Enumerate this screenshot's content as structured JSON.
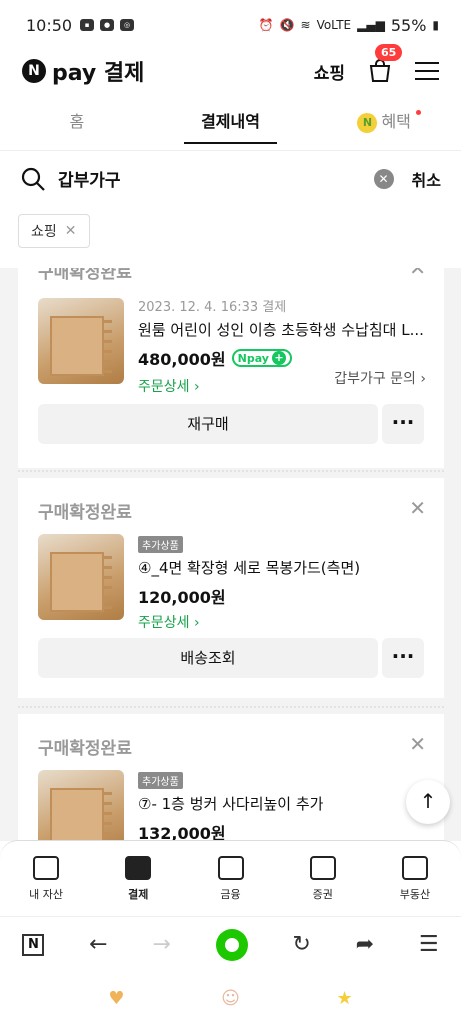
{
  "status": {
    "time": "10:50",
    "battery": "55%",
    "net": "VoLTE"
  },
  "header": {
    "logo_n": "N",
    "logo_text": "pay 결제",
    "shop": "쇼핑",
    "cart_badge": "65"
  },
  "tabs": [
    {
      "label": "홈"
    },
    {
      "label": "결제내역"
    },
    {
      "label": "혜택",
      "coin": "N"
    }
  ],
  "search": {
    "term": "갑부가구",
    "cancel": "취소"
  },
  "filter_chip": {
    "label": "쇼핑"
  },
  "orders": [
    {
      "status": "구매확정완료",
      "date": "2023. 12. 4. 16:33 결제",
      "name": "원룸 어린이 성인 이층 초등학생 수납침대 L...",
      "price": "480,000원",
      "npay_label": "Npay",
      "detail": "주문상세",
      "inquiry": "갑부가구 문의",
      "button": "재구매"
    },
    {
      "status": "구매확정완료",
      "tag": "추가상품",
      "name": "④_4면 확장형 세로 목봉가드(측면)",
      "price": "120,000원",
      "detail": "주문상세",
      "button": "배송조회"
    },
    {
      "status": "구매확정완료",
      "tag": "추가상품",
      "name": "⑦- 1층 벙커 사다리높이 추가",
      "price": "132,000원"
    }
  ],
  "bottom_nav": [
    {
      "label": "내 자산",
      "icon": "wallet-icon"
    },
    {
      "label": "결제",
      "icon": "receipt-icon"
    },
    {
      "label": "금융",
      "icon": "bag-icon"
    },
    {
      "label": "증권",
      "icon": "chart-icon"
    },
    {
      "label": "부동산",
      "icon": "building-icon"
    }
  ],
  "browser": {
    "n": "N"
  },
  "colors": {
    "accent_green": "#16c65e",
    "badge_red": "#ff3b3b"
  }
}
